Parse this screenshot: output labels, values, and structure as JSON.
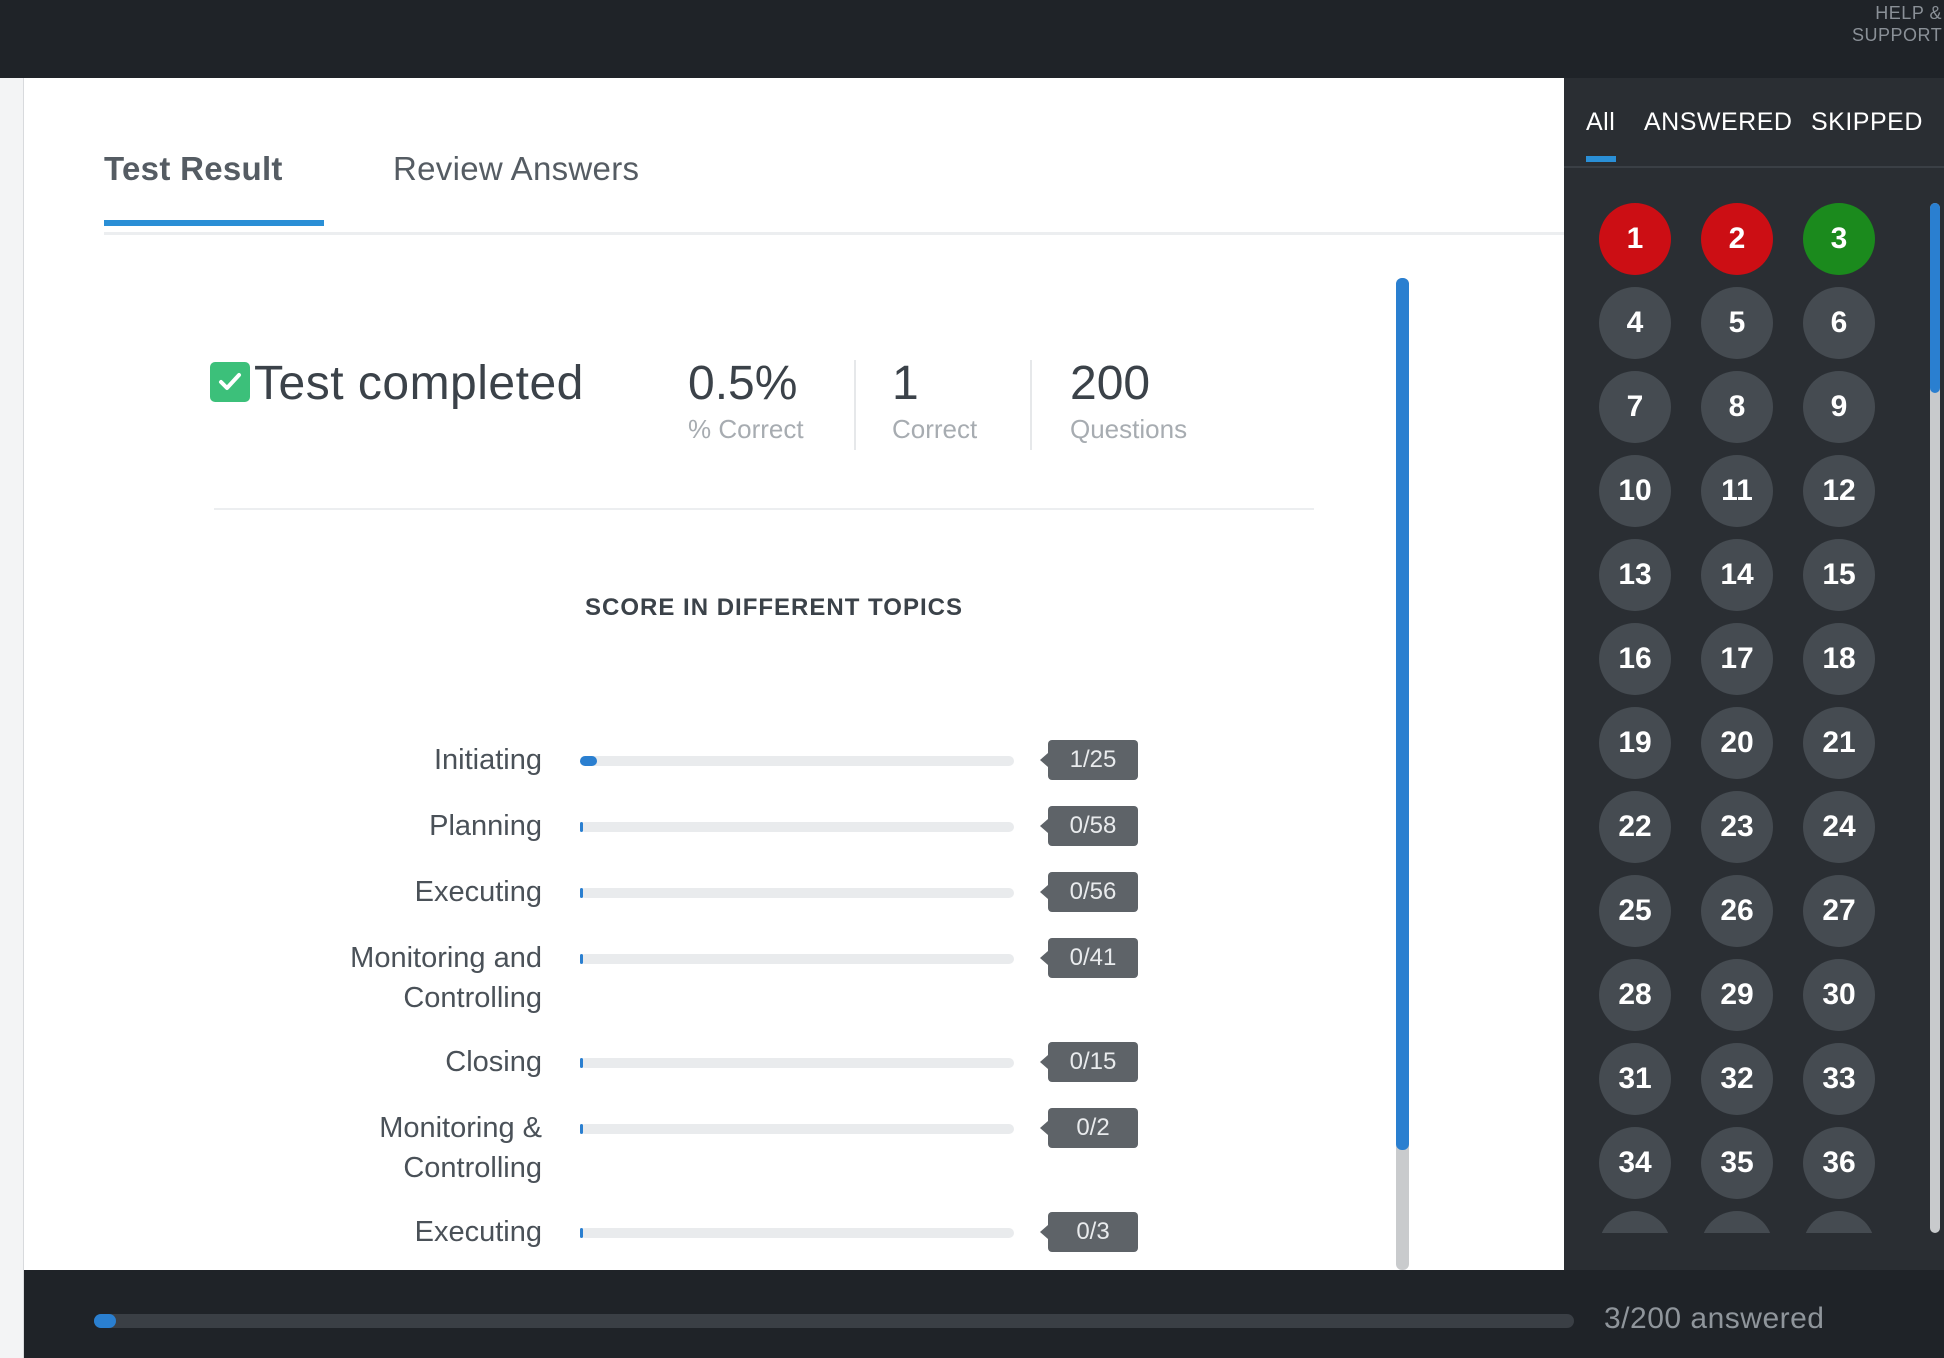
{
  "header": {
    "help_label": "HELP & SUPPORT"
  },
  "tabs": [
    {
      "label": "Test Result",
      "active": true
    },
    {
      "label": "Review Answers",
      "active": false
    }
  ],
  "summary": {
    "status": "Test completed",
    "percent_value": "0.5%",
    "percent_label": "% Correct",
    "correct_value": "1",
    "correct_label": "Correct",
    "questions_value": "200",
    "questions_label": "Questions"
  },
  "topics": {
    "title": "SCORE IN DIFFERENT TOPICS",
    "items": [
      {
        "name": "Initiating",
        "score": "1/25",
        "fraction": 0.04
      },
      {
        "name": "Planning",
        "score": "0/58",
        "fraction": 0
      },
      {
        "name": "Executing",
        "score": "0/56",
        "fraction": 0
      },
      {
        "name": "Monitoring and Controlling",
        "score": "0/41",
        "fraction": 0
      },
      {
        "name": "Closing",
        "score": "0/15",
        "fraction": 0
      },
      {
        "name": "Monitoring & Controlling",
        "score": "0/2",
        "fraction": 0
      },
      {
        "name": "Executing",
        "score": "0/3",
        "fraction": 0
      }
    ]
  },
  "sidebar": {
    "filters": [
      {
        "label": "All",
        "active": true
      },
      {
        "label": "ANSWERED",
        "active": false
      },
      {
        "label": "SKIPPED",
        "active": false
      }
    ],
    "questions": [
      {
        "n": "1",
        "status": "wrong"
      },
      {
        "n": "2",
        "status": "wrong"
      },
      {
        "n": "3",
        "status": "correct"
      },
      {
        "n": "4",
        "status": "none"
      },
      {
        "n": "5",
        "status": "none"
      },
      {
        "n": "6",
        "status": "none"
      },
      {
        "n": "7",
        "status": "none"
      },
      {
        "n": "8",
        "status": "none"
      },
      {
        "n": "9",
        "status": "none"
      },
      {
        "n": "10",
        "status": "none"
      },
      {
        "n": "11",
        "status": "none"
      },
      {
        "n": "12",
        "status": "none"
      },
      {
        "n": "13",
        "status": "none"
      },
      {
        "n": "14",
        "status": "none"
      },
      {
        "n": "15",
        "status": "none"
      },
      {
        "n": "16",
        "status": "none"
      },
      {
        "n": "17",
        "status": "none"
      },
      {
        "n": "18",
        "status": "none"
      },
      {
        "n": "19",
        "status": "none"
      },
      {
        "n": "20",
        "status": "none"
      },
      {
        "n": "21",
        "status": "none"
      },
      {
        "n": "22",
        "status": "none"
      },
      {
        "n": "23",
        "status": "none"
      },
      {
        "n": "24",
        "status": "none"
      },
      {
        "n": "25",
        "status": "none"
      },
      {
        "n": "26",
        "status": "none"
      },
      {
        "n": "27",
        "status": "none"
      },
      {
        "n": "28",
        "status": "none"
      },
      {
        "n": "29",
        "status": "none"
      },
      {
        "n": "30",
        "status": "none"
      },
      {
        "n": "31",
        "status": "none"
      },
      {
        "n": "32",
        "status": "none"
      },
      {
        "n": "33",
        "status": "none"
      },
      {
        "n": "34",
        "status": "none"
      },
      {
        "n": "35",
        "status": "none"
      },
      {
        "n": "36",
        "status": "none"
      },
      {
        "n": "",
        "status": "none"
      },
      {
        "n": "",
        "status": "none"
      },
      {
        "n": "",
        "status": "none"
      }
    ]
  },
  "footer": {
    "answered_text": "3/200 answered",
    "progress_fraction": 0.015
  },
  "colors": {
    "accent": "#2a8fd6",
    "wrong": "#cc0e14",
    "correct": "#1b8a1d",
    "unanswered": "#454b51",
    "check": "#3cc07a"
  }
}
